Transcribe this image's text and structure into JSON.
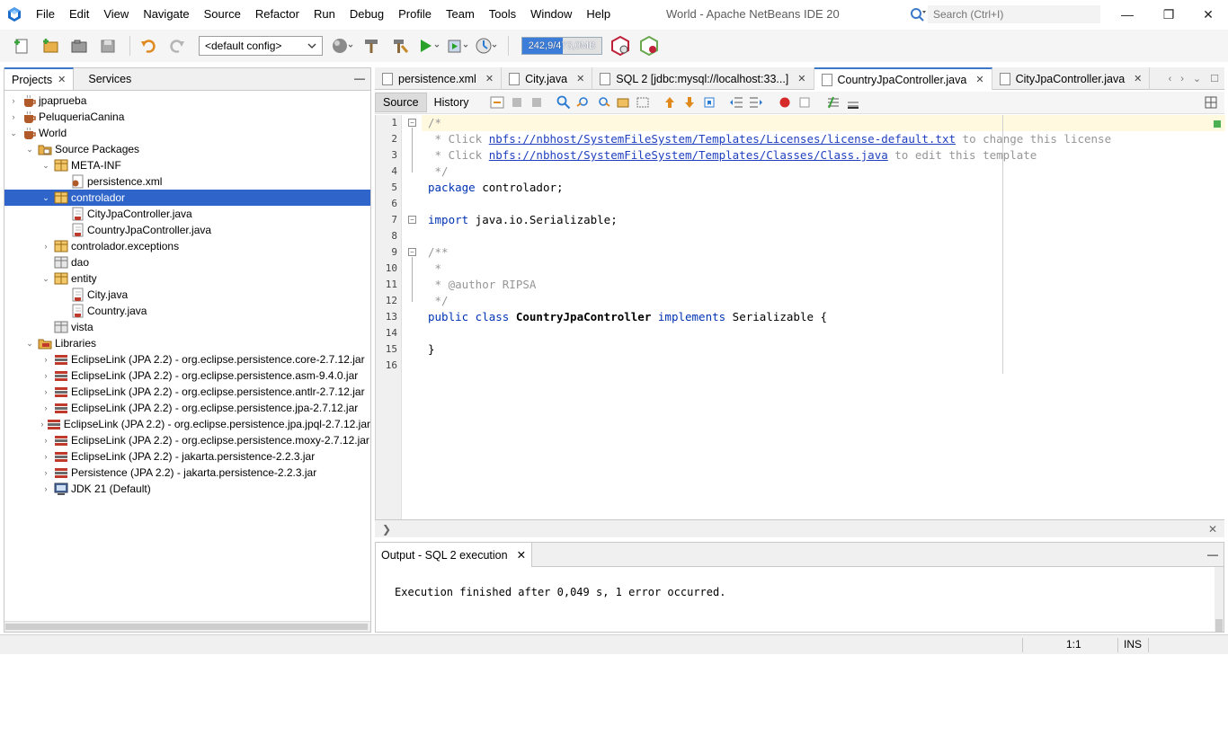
{
  "window": {
    "title": "World - Apache NetBeans IDE 20",
    "minimize": "—",
    "maximize": "❐",
    "close": "✕"
  },
  "menu": [
    "File",
    "Edit",
    "View",
    "Navigate",
    "Source",
    "Refactor",
    "Run",
    "Debug",
    "Profile",
    "Team",
    "Tools",
    "Window",
    "Help"
  ],
  "search": {
    "placeholder": "Search (Ctrl+I)"
  },
  "toolbar": {
    "config": "<default config>",
    "memory": "242,9/473,0MB",
    "memory_fraction": 0.51
  },
  "left_panel": {
    "tabs": [
      {
        "label": "Projects",
        "close": "✕"
      },
      {
        "label": "Services"
      }
    ],
    "minimize": "—"
  },
  "tree": [
    {
      "label": "jpaprueba",
      "toggle": "›",
      "icon": "project-icon"
    },
    {
      "label": "PeluqueriaCanina",
      "toggle": "›",
      "icon": "project-icon"
    },
    {
      "label": "World",
      "toggle": "⌄",
      "icon": "project-icon"
    },
    {
      "label": "Source Packages",
      "toggle": "⌄",
      "icon": "source-packages-icon"
    },
    {
      "label": "META-INF",
      "toggle": "⌄",
      "icon": "package-icon"
    },
    {
      "label": "persistence.xml",
      "toggle": "",
      "icon": "xml-file-icon"
    },
    {
      "label": "controlador",
      "toggle": "⌄",
      "icon": "package-icon"
    },
    {
      "label": "CityJpaController.java",
      "toggle": "",
      "icon": "java-file-icon"
    },
    {
      "label": "CountryJpaController.java",
      "toggle": "",
      "icon": "java-file-icon"
    },
    {
      "label": "controlador.exceptions",
      "toggle": "›",
      "icon": "package-icon"
    },
    {
      "label": "dao",
      "toggle": "",
      "icon": "empty-package-icon"
    },
    {
      "label": "entity",
      "toggle": "⌄",
      "icon": "package-icon"
    },
    {
      "label": "City.java",
      "toggle": "",
      "icon": "java-file-icon"
    },
    {
      "label": "Country.java",
      "toggle": "",
      "icon": "java-file-icon"
    },
    {
      "label": "vista",
      "toggle": "",
      "icon": "empty-package-icon"
    },
    {
      "label": "Libraries",
      "toggle": "⌄",
      "icon": "libraries-icon"
    },
    {
      "label": "EclipseLink (JPA 2.2) - org.eclipse.persistence.core-2.7.12.jar",
      "toggle": "›",
      "icon": "jar-icon"
    },
    {
      "label": "EclipseLink (JPA 2.2) - org.eclipse.persistence.asm-9.4.0.jar",
      "toggle": "›",
      "icon": "jar-icon"
    },
    {
      "label": "EclipseLink (JPA 2.2) - org.eclipse.persistence.antlr-2.7.12.jar",
      "toggle": "›",
      "icon": "jar-icon"
    },
    {
      "label": "EclipseLink (JPA 2.2) - org.eclipse.persistence.jpa-2.7.12.jar",
      "toggle": "›",
      "icon": "jar-icon"
    },
    {
      "label": "EclipseLink (JPA 2.2) - org.eclipse.persistence.jpa.jpql-2.7.12.jar",
      "toggle": "›",
      "icon": "jar-icon"
    },
    {
      "label": "EclipseLink (JPA 2.2) - org.eclipse.persistence.moxy-2.7.12.jar",
      "toggle": "›",
      "icon": "jar-icon"
    },
    {
      "label": "EclipseLink (JPA 2.2) - jakarta.persistence-2.2.3.jar",
      "toggle": "›",
      "icon": "jar-icon"
    },
    {
      "label": "Persistence (JPA 2.2) - jakarta.persistence-2.2.3.jar",
      "toggle": "›",
      "icon": "jar-icon"
    },
    {
      "label": "JDK 21 (Default)",
      "toggle": "›",
      "icon": "jdk-icon"
    }
  ],
  "editor": {
    "tabs": [
      {
        "label": "persistence.xml",
        "close": "✕"
      },
      {
        "label": "City.java",
        "close": "✕"
      },
      {
        "label": "SQL 2 [jdbc:mysql://localhost:33...]",
        "close": "✕"
      },
      {
        "label": "CountryJpaController.java",
        "close": "✕"
      },
      {
        "label": "CityJpaController.java",
        "close": "✕"
      }
    ],
    "nav": [
      "‹",
      "›",
      "⌄",
      "☐"
    ],
    "source_label": "Source",
    "history_label": "History",
    "line_numbers": [
      "1",
      "2",
      "3",
      "4",
      "5",
      "6",
      "7",
      "8",
      "9",
      "10",
      "11",
      "12",
      "13",
      "14",
      "15",
      "16"
    ],
    "fold_markers": [
      "−",
      "−",
      "−"
    ],
    "code": {
      "l1": "/*",
      "l2_pre": " * Click ",
      "l2_link": "nbfs://nbhost/SystemFileSystem/Templates/Licenses/license-default.txt",
      "l2_post": " to change this license",
      "l3_pre": " * Click ",
      "l3_link": "nbfs://nbhost/SystemFileSystem/Templates/Classes/Class.java",
      "l3_post": " to edit this template",
      "l4": " */",
      "l5_kw": "package",
      "l5_rest": " controlador;",
      "l7_kw": "import",
      "l7_rest": " java.io.Serializable;",
      "l9": "/**",
      "l10": " *",
      "l11": " * @author RIPSA",
      "l12": " */",
      "l13_kw1": "public class",
      "l13_name": " CountryJpaController ",
      "l13_kw2": "implements",
      "l13_rest": " Serializable {",
      "l15": "}"
    },
    "status_expand": "❯",
    "status_close": "✕"
  },
  "output": {
    "tab_label": "Output - SQL 2 execution",
    "tab_close": "✕",
    "minimize": "—",
    "text": "Execution finished after 0,049 s, 1 error occurred."
  },
  "statusbar": {
    "position": "1:1",
    "mode": "INS"
  },
  "colors": {
    "selection": "#2f65ca",
    "accent_tab": "#3c78c8",
    "keyword": "#0033b3",
    "comment": "#969696",
    "link": "#1f3fbf"
  }
}
